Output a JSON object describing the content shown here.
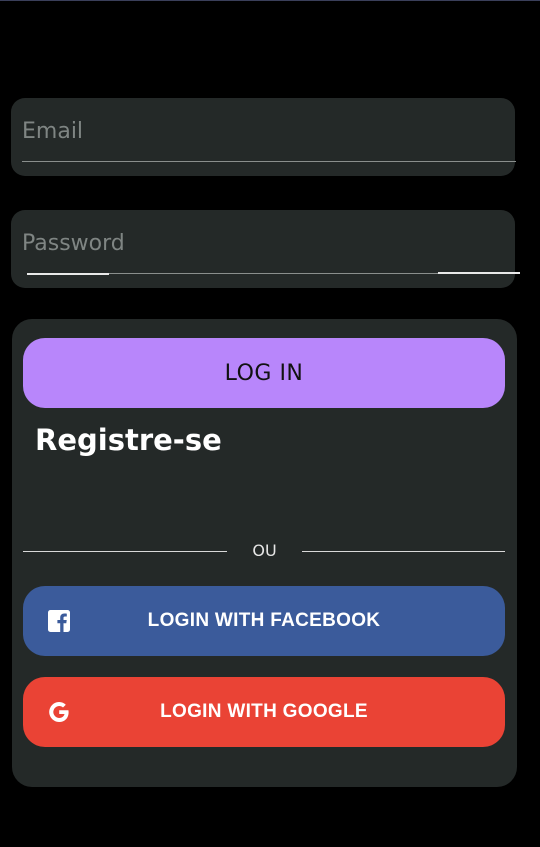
{
  "form": {
    "email": {
      "placeholder": "Email",
      "value": ""
    },
    "password": {
      "placeholder": "Password",
      "value": ""
    }
  },
  "actions": {
    "login_label": "LOG IN",
    "register_label": "Registre-se",
    "divider_text": "OU",
    "facebook_label": "LOGIN WITH FACEBOOK",
    "google_label": "LOGIN WITH GOOGLE"
  },
  "icons": {
    "facebook": "facebook-icon",
    "google": "google-icon"
  },
  "colors": {
    "background": "#000000",
    "card": "#242928",
    "login_button": "#b886fb",
    "facebook_button": "#3b5b9b",
    "google_button": "#ea4335"
  }
}
